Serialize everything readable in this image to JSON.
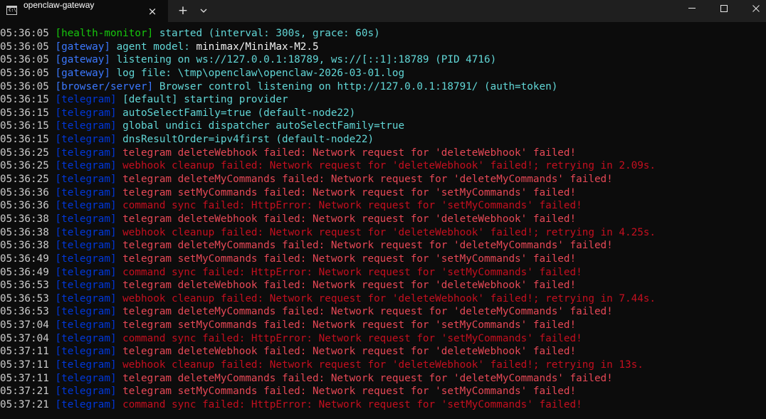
{
  "window": {
    "tab_title": "openclaw-gateway",
    "tab_icon_label": "C:\\",
    "tab_icon": "console-icon",
    "close_tab": "×",
    "new_tab": "+",
    "dropdown_icon": "chevron-down-icon",
    "controls": [
      "minimize-icon",
      "maximize-icon",
      "close-icon"
    ]
  },
  "colors": {
    "background": "#0c0c0c",
    "timestamp": "#cccccc",
    "health": "#16c60c",
    "gateway": "#3b78ff",
    "telegram": "#0037da",
    "info": "#61d6d6",
    "value": "#f2f2f2",
    "error": "#e74856",
    "error_dim": "#c50f1f"
  },
  "log": [
    {
      "ts": "05:36:05",
      "tag": "[health-monitor]",
      "kind": "health",
      "parts": [
        {
          "t": "started (interval: 300s, grace: 60s)",
          "c": "cyan"
        }
      ]
    },
    {
      "ts": "05:36:05",
      "tag": "[gateway]",
      "kind": "gateway",
      "parts": [
        {
          "t": "agent model: ",
          "c": "cyan"
        },
        {
          "t": "minimax/MiniMax-M2.5",
          "c": "white"
        }
      ]
    },
    {
      "ts": "05:36:05",
      "tag": "[gateway]",
      "kind": "gateway",
      "parts": [
        {
          "t": "listening on ws://127.0.0.1:18789, ws://[::1]:18789 (PID 4716)",
          "c": "cyan"
        }
      ]
    },
    {
      "ts": "05:36:05",
      "tag": "[gateway]",
      "kind": "gateway",
      "parts": [
        {
          "t": "log file: \\tmp\\openclaw\\openclaw-2026-03-01.log",
          "c": "cyan"
        }
      ]
    },
    {
      "ts": "05:36:05",
      "tag": "[browser/server]",
      "kind": "browser",
      "parts": [
        {
          "t": "Browser control listening on http://127.0.0.1:18791/ (auth=token)",
          "c": "cyan"
        }
      ]
    },
    {
      "ts": "05:36:15",
      "tag": "[telegram]",
      "kind": "telegram",
      "parts": [
        {
          "t": "[default] starting provider",
          "c": "cyan"
        }
      ]
    },
    {
      "ts": "05:36:15",
      "tag": "[telegram]",
      "kind": "telegram",
      "parts": [
        {
          "t": "autoSelectFamily=true (default-node22)",
          "c": "cyan"
        }
      ]
    },
    {
      "ts": "05:36:15",
      "tag": "[telegram]",
      "kind": "telegram",
      "parts": [
        {
          "t": "global undici dispatcher autoSelectFamily=true",
          "c": "cyan"
        }
      ]
    },
    {
      "ts": "05:36:15",
      "tag": "[telegram]",
      "kind": "telegram",
      "parts": [
        {
          "t": "dnsResultOrder=ipv4first (default-node22)",
          "c": "cyan"
        }
      ]
    },
    {
      "ts": "05:36:25",
      "tag": "[telegram]",
      "kind": "telegram",
      "parts": [
        {
          "t": "telegram deleteWebhook failed: Network request for 'deleteWebhook' failed!",
          "c": "bred"
        }
      ]
    },
    {
      "ts": "05:36:25",
      "tag": "[telegram]",
      "kind": "telegram",
      "parts": [
        {
          "t": "webhook cleanup failed: Network request for 'deleteWebhook' failed!; retrying in 2.09s.",
          "c": "red"
        }
      ]
    },
    {
      "ts": "05:36:25",
      "tag": "[telegram]",
      "kind": "telegram",
      "parts": [
        {
          "t": "telegram deleteMyCommands failed: Network request for 'deleteMyCommands' failed!",
          "c": "bred"
        }
      ]
    },
    {
      "ts": "05:36:36",
      "tag": "[telegram]",
      "kind": "telegram",
      "parts": [
        {
          "t": "telegram setMyCommands failed: Network request for 'setMyCommands' failed!",
          "c": "bred"
        }
      ]
    },
    {
      "ts": "05:36:36",
      "tag": "[telegram]",
      "kind": "telegram",
      "parts": [
        {
          "t": "command sync failed: HttpError: Network request for 'setMyCommands' failed!",
          "c": "red"
        }
      ]
    },
    {
      "ts": "05:36:38",
      "tag": "[telegram]",
      "kind": "telegram",
      "parts": [
        {
          "t": "telegram deleteWebhook failed: Network request for 'deleteWebhook' failed!",
          "c": "bred"
        }
      ]
    },
    {
      "ts": "05:36:38",
      "tag": "[telegram]",
      "kind": "telegram",
      "parts": [
        {
          "t": "webhook cleanup failed: Network request for 'deleteWebhook' failed!; retrying in 4.25s.",
          "c": "red"
        }
      ]
    },
    {
      "ts": "05:36:38",
      "tag": "[telegram]",
      "kind": "telegram",
      "parts": [
        {
          "t": "telegram deleteMyCommands failed: Network request for 'deleteMyCommands' failed!",
          "c": "bred"
        }
      ]
    },
    {
      "ts": "05:36:49",
      "tag": "[telegram]",
      "kind": "telegram",
      "parts": [
        {
          "t": "telegram setMyCommands failed: Network request for 'setMyCommands' failed!",
          "c": "bred"
        }
      ]
    },
    {
      "ts": "05:36:49",
      "tag": "[telegram]",
      "kind": "telegram",
      "parts": [
        {
          "t": "command sync failed: HttpError: Network request for 'setMyCommands' failed!",
          "c": "red"
        }
      ]
    },
    {
      "ts": "05:36:53",
      "tag": "[telegram]",
      "kind": "telegram",
      "parts": [
        {
          "t": "telegram deleteWebhook failed: Network request for 'deleteWebhook' failed!",
          "c": "bred"
        }
      ]
    },
    {
      "ts": "05:36:53",
      "tag": "[telegram]",
      "kind": "telegram",
      "parts": [
        {
          "t": "webhook cleanup failed: Network request for 'deleteWebhook' failed!; retrying in 7.44s.",
          "c": "red"
        }
      ]
    },
    {
      "ts": "05:36:53",
      "tag": "[telegram]",
      "kind": "telegram",
      "parts": [
        {
          "t": "telegram deleteMyCommands failed: Network request for 'deleteMyCommands' failed!",
          "c": "bred"
        }
      ]
    },
    {
      "ts": "05:37:04",
      "tag": "[telegram]",
      "kind": "telegram",
      "parts": [
        {
          "t": "telegram setMyCommands failed: Network request for 'setMyCommands' failed!",
          "c": "bred"
        }
      ]
    },
    {
      "ts": "05:37:04",
      "tag": "[telegram]",
      "kind": "telegram",
      "parts": [
        {
          "t": "command sync failed: HttpError: Network request for 'setMyCommands' failed!",
          "c": "red"
        }
      ]
    },
    {
      "ts": "05:37:11",
      "tag": "[telegram]",
      "kind": "telegram",
      "parts": [
        {
          "t": "telegram deleteWebhook failed: Network request for 'deleteWebhook' failed!",
          "c": "bred"
        }
      ]
    },
    {
      "ts": "05:37:11",
      "tag": "[telegram]",
      "kind": "telegram",
      "parts": [
        {
          "t": "webhook cleanup failed: Network request for 'deleteWebhook' failed!; retrying in 13s.",
          "c": "red"
        }
      ]
    },
    {
      "ts": "05:37:11",
      "tag": "[telegram]",
      "kind": "telegram",
      "parts": [
        {
          "t": "telegram deleteMyCommands failed: Network request for 'deleteMyCommands' failed!",
          "c": "bred"
        }
      ]
    },
    {
      "ts": "05:37:21",
      "tag": "[telegram]",
      "kind": "telegram",
      "parts": [
        {
          "t": "telegram setMyCommands failed: Network request for 'setMyCommands' failed!",
          "c": "bred"
        }
      ]
    },
    {
      "ts": "05:37:21",
      "tag": "[telegram]",
      "kind": "telegram",
      "parts": [
        {
          "t": "command sync failed: HttpError: Network request for 'setMyCommands' failed!",
          "c": "red"
        }
      ]
    }
  ]
}
